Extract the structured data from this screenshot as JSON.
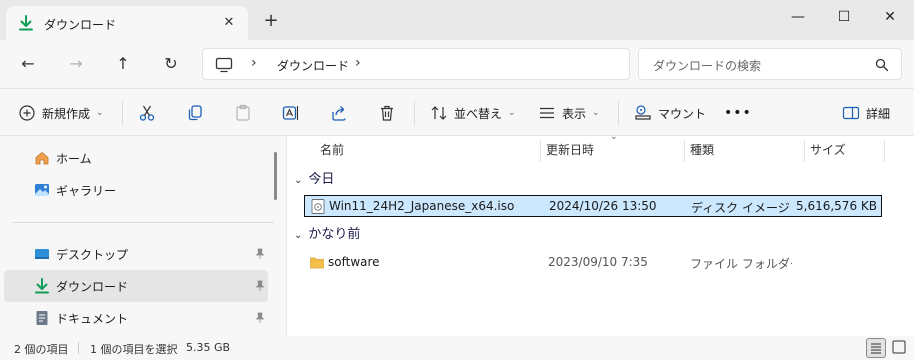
{
  "tab": {
    "title": "ダウンロード",
    "close_glyph": "✕",
    "new_tab_glyph": "+"
  },
  "window_controls": {
    "minimize": "—",
    "maximize": "☐",
    "close": "✕"
  },
  "nav": {
    "back": "←",
    "forward": "→",
    "up": "↑",
    "refresh": "↻"
  },
  "breadcrumb": {
    "chevron": "›",
    "folder": "ダウンロード"
  },
  "search": {
    "placeholder": "ダウンロードの検索"
  },
  "toolbar": {
    "new_label": "新規作成",
    "sort_label": "並べ替え",
    "view_label": "表示",
    "mount_label": "マウント",
    "more_label": "•••",
    "details_label": "詳細",
    "dropdown_glyph": "⌄"
  },
  "sidebar": {
    "items": [
      {
        "label": "ホーム",
        "icon": "home-icon"
      },
      {
        "label": "ギャラリー",
        "icon": "gallery-icon"
      },
      {
        "label": "デスクトップ",
        "icon": "desktop-icon",
        "pinned": true
      },
      {
        "label": "ダウンロード",
        "icon": "download-icon",
        "pinned": true,
        "selected": true
      },
      {
        "label": "ドキュメント",
        "icon": "document-icon",
        "pinned": true
      }
    ]
  },
  "columns": {
    "name": "名前",
    "date": "更新日時",
    "type": "種類",
    "size": "サイズ"
  },
  "groups": [
    {
      "label": "今日",
      "files": [
        {
          "name": "Win11_24H2_Japanese_x64.iso",
          "date": "2024/10/26 13:50",
          "type": "ディスク イメージ ファイル",
          "size": "5,616,576 KB",
          "icon": "disc-image-icon",
          "selected": true
        }
      ]
    },
    {
      "label": "かなり前",
      "files": [
        {
          "name": "software",
          "date": "2023/09/10 7:35",
          "type": "ファイル フォルダー",
          "size": "",
          "icon": "folder-icon",
          "selected": false
        }
      ]
    }
  ],
  "status": {
    "item_count": "2 個の項目",
    "selection": "1 個の項目を選択",
    "selection_size": "5.35 GB"
  },
  "colors": {
    "accent_green": "#0f9d58",
    "selection_bg": "#cce8ff",
    "folder_yellow": "#f5c04a"
  }
}
